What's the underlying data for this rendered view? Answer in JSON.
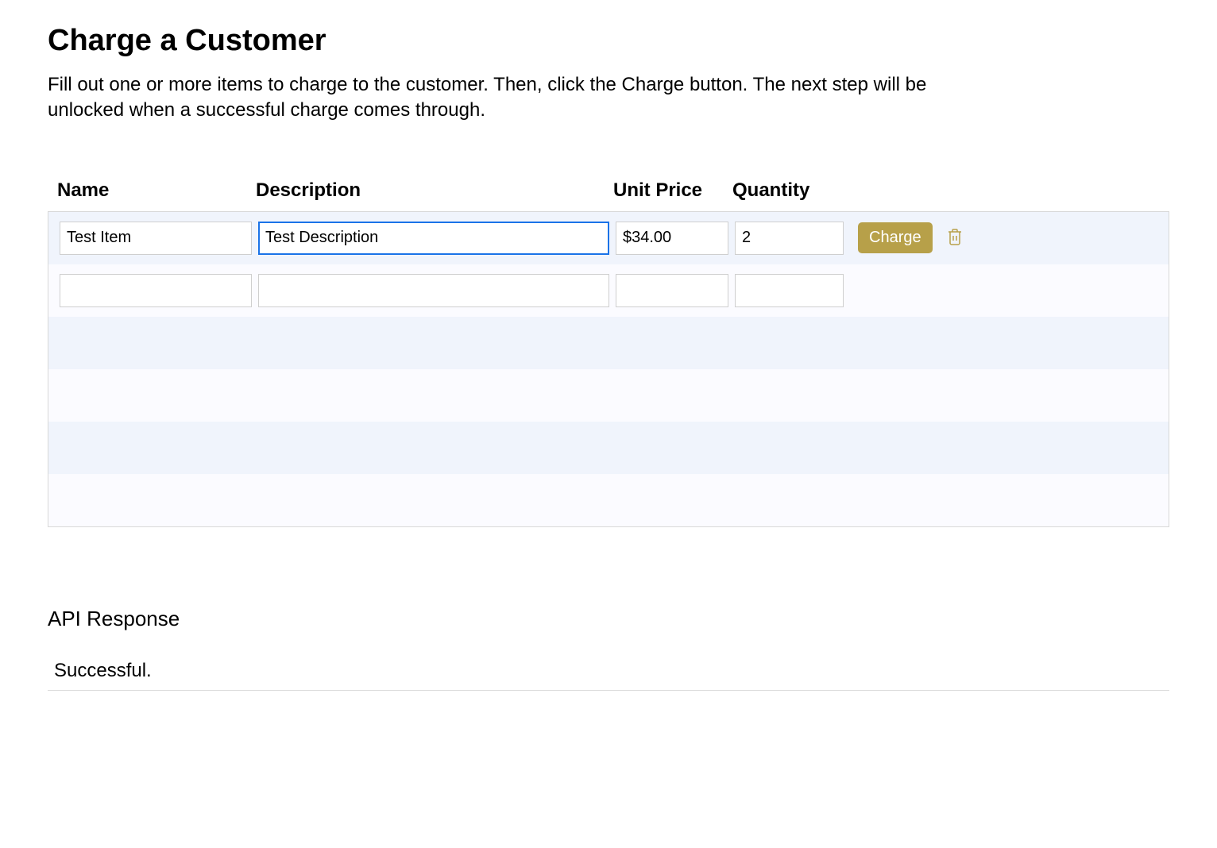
{
  "header": {
    "title": "Charge a Customer",
    "intro": "Fill out one or more items to charge to the customer. Then, click the Charge button. The next step will be unlocked when a successful charge comes through."
  },
  "table": {
    "columns": {
      "name": "Name",
      "description": "Description",
      "unit_price": "Unit Price",
      "quantity": "Quantity"
    },
    "rows": [
      {
        "name": "Test Item",
        "description": "Test Description",
        "unit_price": "$34.00",
        "quantity": "2",
        "focused_field": "description",
        "has_actions": true
      },
      {
        "name": "",
        "description": "",
        "unit_price": "",
        "quantity": "",
        "focused_field": null,
        "has_actions": false
      }
    ],
    "empty_rows": 4,
    "charge_label": "Charge"
  },
  "api": {
    "heading": "API Response",
    "status": "Successful."
  },
  "colors": {
    "accent": "#b7a049",
    "focus": "#1a73e8",
    "stripe_even": "#f0f4fc",
    "stripe_odd": "#fbfbff"
  }
}
